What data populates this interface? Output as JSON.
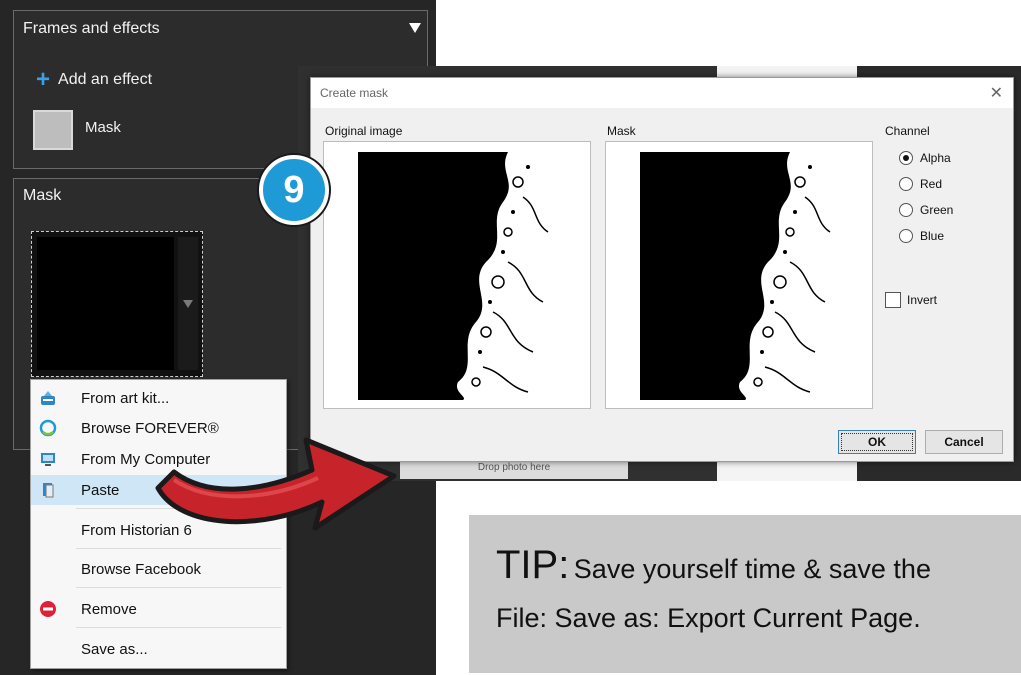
{
  "frames_effects": {
    "title": "Frames and effects",
    "add_effect_label": "Add an effect",
    "mask_effect_label": "Mask"
  },
  "mask_panel": {
    "title": "Mask"
  },
  "context_menu": {
    "items": [
      {
        "label": "From art kit...",
        "icon": "art-kit-icon"
      },
      {
        "label": "Browse FOREVER®",
        "icon": "forever-icon"
      },
      {
        "label": "From My Computer",
        "icon": "computer-icon"
      },
      {
        "label": "Paste",
        "icon": "paste-icon",
        "highlighted": true
      },
      {
        "label": "From Historian 6",
        "icon": ""
      },
      {
        "label": "Browse Facebook",
        "icon": ""
      },
      {
        "label": "Remove",
        "icon": "remove-icon"
      },
      {
        "label": "Save as...",
        "icon": ""
      }
    ]
  },
  "drop_photo_text": "Drop photo here",
  "step_badge": "9",
  "dialog": {
    "title": "Create mask",
    "original_label": "Original image",
    "mask_label": "Mask",
    "channel_label": "Channel",
    "channels": [
      {
        "label": "Alpha",
        "selected": true
      },
      {
        "label": "Red",
        "selected": false
      },
      {
        "label": "Green",
        "selected": false
      },
      {
        "label": "Blue",
        "selected": false
      }
    ],
    "invert_label": "Invert",
    "invert_checked": false,
    "ok_label": "OK",
    "cancel_label": "Cancel"
  },
  "tip": {
    "prefix": "TIP:",
    "line1": "Save yourself time & save the",
    "line2": "File: Save as: Export Current Page."
  },
  "colors": {
    "panel_bg": "#262626",
    "accent_blue": "#1e9ad6",
    "arrow_red": "#c7232a",
    "menu_highlight": "#cfe6f6",
    "tip_bg": "#c9c9c9"
  }
}
